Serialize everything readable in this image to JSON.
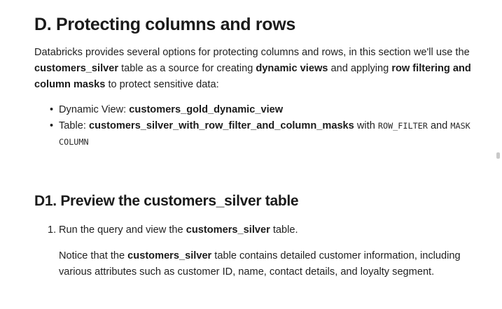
{
  "section_d": {
    "title": "D. Protecting columns and rows",
    "intro": {
      "p1": "Databricks provides several options for protecting columns and rows, in this section we'll use the ",
      "b1": "customers_silver",
      "p2": " table as a source for creating ",
      "b2": "dynamic views",
      "p3": " and applying ",
      "b3": "row filtering and column masks",
      "p4": " to protect sensitive data:"
    },
    "bullets": [
      {
        "prefix": "Dynamic View: ",
        "bold": "customers_gold_dynamic_view"
      },
      {
        "prefix": "Table: ",
        "bold": "customers_silver_with_row_filter_and_column_masks",
        "mid": " with ",
        "code1": "ROW_FILTER",
        "and": " and ",
        "code2": "MASK COLUMN"
      }
    ]
  },
  "section_d1": {
    "title": "D1. Preview the customers_silver table",
    "steps": [
      {
        "number": "1.",
        "p1": "Run the query and view the ",
        "bold": "customers_silver",
        "p2": " table."
      }
    ],
    "notice": {
      "p1": "Notice that the ",
      "bold": "customers_silver",
      "p2": " table contains detailed customer information, including various attributes such as customer ID, name, contact details, and loyalty segment."
    }
  },
  "bullet_glyph": "•"
}
